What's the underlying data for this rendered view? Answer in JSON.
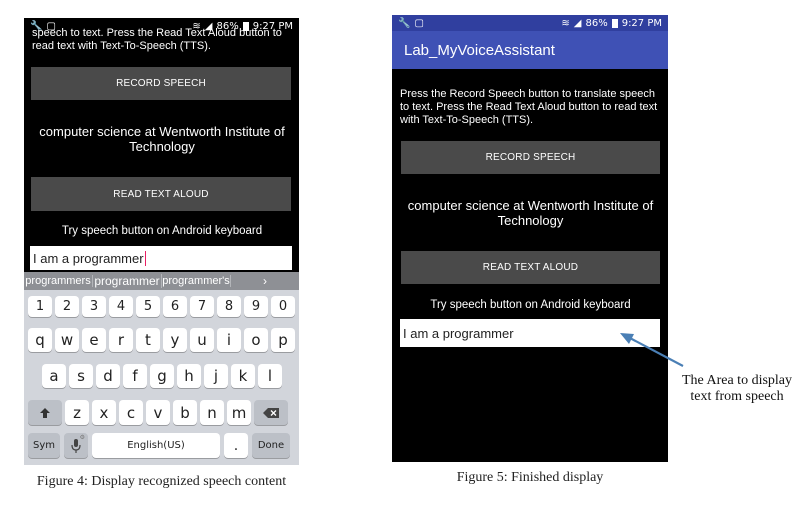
{
  "status_bar": {
    "left_icons": [
      "wrench-icon",
      "square-icon"
    ],
    "battery": "86%",
    "time": "9:27 PM"
  },
  "figure4": {
    "instructions": "speech to text. Press the Read Text Aloud button to read text with Text-To-Speech (TTS).",
    "record_button": "RECORD SPEECH",
    "result_text": "computer science at Wentworth Institute of Technology",
    "read_button": "READ TEXT ALOUD",
    "hint": "Try speech button on Android keyboard",
    "input_value": "I am a programmer",
    "keyboard": {
      "suggestions": [
        "programmers",
        "programmer",
        "programmer's"
      ],
      "suggest_arrow": "›",
      "number_row": [
        "1",
        "2",
        "3",
        "4",
        "5",
        "6",
        "7",
        "8",
        "9",
        "0"
      ],
      "row1": [
        "q",
        "w",
        "e",
        "r",
        "t",
        "y",
        "u",
        "i",
        "o",
        "p"
      ],
      "row2": [
        "a",
        "s",
        "d",
        "f",
        "g",
        "h",
        "j",
        "k",
        "l"
      ],
      "row3": [
        "z",
        "x",
        "c",
        "v",
        "b",
        "n",
        "m"
      ],
      "sym_label": "Sym",
      "space_label": "English(US)",
      "period_label": ".",
      "done_label": "Done"
    },
    "caption": "Figure 4: Display recognized speech content"
  },
  "figure5": {
    "app_title": "Lab_MyVoiceAssistant",
    "instructions": "Press the Record Speech button to translate speech to text. Press the Read Text Aloud button to read text with Text-To-Speech (TTS).",
    "record_button": "RECORD SPEECH",
    "result_text": "computer science at Wentworth Institute of Technology",
    "read_button": "READ TEXT ALOUD",
    "hint": "Try speech button on Android keyboard",
    "input_value": "I am a programmer",
    "caption": "Figure 5: Finished display"
  },
  "annotation": "The Area to display text from speech",
  "colors": {
    "app_bar": "#3f51b5",
    "status_bar": "#303f9f",
    "button": "#4a4a4a",
    "arrow": "#4a7fb5",
    "caret": "#e91e63"
  }
}
